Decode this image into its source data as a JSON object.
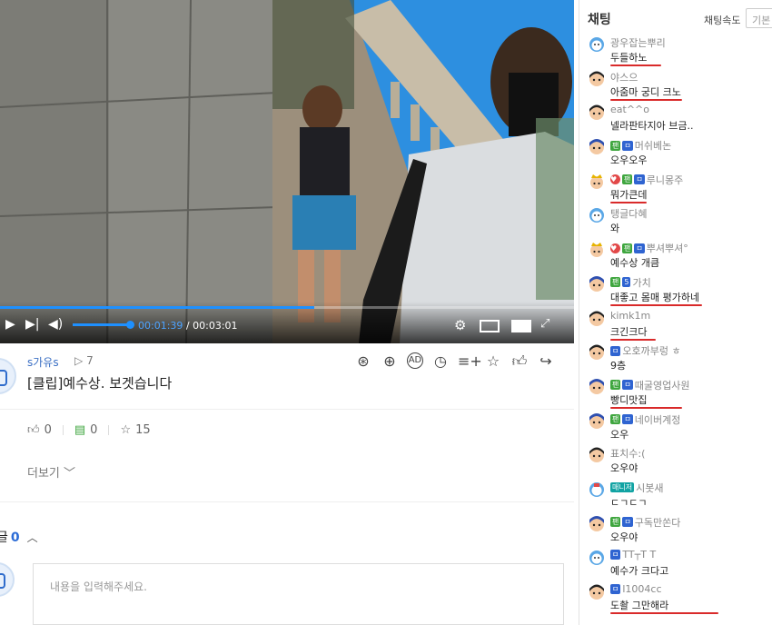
{
  "player": {
    "current_time": "00:01:39",
    "total_time": "00:03:01",
    "time_separator": "/",
    "progress_fraction": 0.547,
    "volume_fraction": 0.95
  },
  "video_info": {
    "streamer": "s가유s",
    "views_icon": "play-outline-icon",
    "views": "7",
    "title": "[클립]예수상. 보겟습니다",
    "action_icons": [
      "badge-icon",
      "upload-clip-icon",
      "ad-icon",
      "history-icon",
      "playlist-add-icon",
      "star-outline-icon",
      "thumb-up-outline-icon",
      "share-icon"
    ]
  },
  "stats": {
    "likes": "0",
    "comments": "0",
    "bookmarks": "15"
  },
  "more_label": "더보기",
  "comments": {
    "label": "글",
    "count": "0",
    "placeholder": "내용을 입력해주세요."
  },
  "chat": {
    "title": "채팅",
    "speed_label": "채팅속도",
    "speed_value": "기본",
    "messages": [
      {
        "nick": "광우잡는뿌리",
        "text": "두들하노",
        "emoji": "bear",
        "badges": [],
        "underline": 0.31
      },
      {
        "nick": "야스으",
        "text": "아줌마 궁디 크노",
        "emoji": "boy",
        "badges": [],
        "underline": 0.44
      },
      {
        "nick": "eat^^o",
        "text": "넬라판타지아 브금..",
        "emoji": "boy",
        "badges": [],
        "underline": 0
      },
      {
        "nick": "머쉬베논",
        "text": "오우오우",
        "emoji": "fan",
        "badges": [
          "팬",
          "ㅁ"
        ],
        "underline": 0
      },
      {
        "nick": "루니몽주",
        "text": "뭐가큰데",
        "emoji": "king",
        "badges": [
          "♥",
          "팬",
          "ㅁ"
        ],
        "underline": 0.22
      },
      {
        "nick": "탱글다혜",
        "text": "와",
        "emoji": "bear",
        "badges": [],
        "underline": 0
      },
      {
        "nick": "뿌셔뿌셔°",
        "text": "예수상 개큼",
        "emoji": "king",
        "badges": [
          "♥",
          "팬",
          "ㅁ"
        ],
        "underline": 0
      },
      {
        "nick": "가치",
        "text": "대좋고 몸매 평가하네",
        "emoji": "fan",
        "badges": [
          "팬",
          "5"
        ],
        "underline": 0.56
      },
      {
        "nick": "kimk1m",
        "text": "크긴크다",
        "emoji": "boy",
        "badges": [],
        "underline": 0.28
      },
      {
        "nick": "오호까부렁 ㅎ",
        "text": "9층",
        "emoji": "boy",
        "badges": [
          "ㅁ"
        ],
        "underline": 0
      },
      {
        "nick": "때굴영업사원",
        "text": "빵디맛집",
        "emoji": "fan",
        "badges": [
          "팬",
          "ㅁ"
        ],
        "underline": 0.44
      },
      {
        "nick": "네이버계정",
        "text": "오우",
        "emoji": "fan",
        "badges": [
          "팬",
          "ㅁ"
        ],
        "underline": 0
      },
      {
        "nick": "표치수:(",
        "text": "오우야",
        "emoji": "boy",
        "badges": [],
        "underline": 0
      },
      {
        "nick": "시봇새",
        "text": "ㄷㄱㄷㄱ",
        "emoji": "manager",
        "badges": [
          "매니저"
        ],
        "underline": 0
      },
      {
        "nick": "구독만쏜다",
        "text": "오우야",
        "emoji": "fan",
        "badges": [
          "팬",
          "ㅁ"
        ],
        "underline": 0
      },
      {
        "nick": "TT┬T T",
        "text": "예수가 크다고",
        "emoji": "bear",
        "badges": [
          "ㅁ"
        ],
        "underline": 0
      },
      {
        "nick": "l1004cc",
        "text": "도촬 그만해라",
        "emoji": "boy",
        "badges": [
          "ㅁ"
        ],
        "underline": 0.66
      }
    ]
  },
  "colors": {
    "accent": "#1e90ff",
    "streamer_name": "#3a6fc4",
    "annotation_red": "#d92a2a",
    "comment_count": "#2b6bd6"
  }
}
